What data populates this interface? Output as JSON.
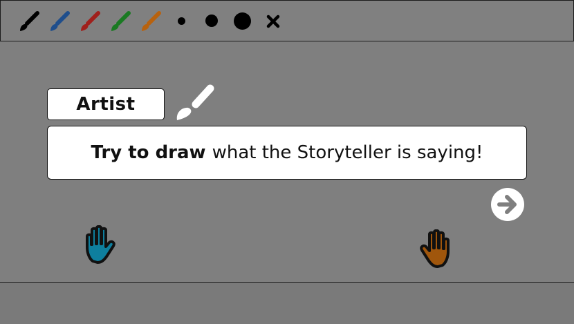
{
  "toolbar": {
    "brushes": [
      {
        "icon": "black-brush-icon",
        "color": "#000000"
      },
      {
        "icon": "blue-brush-icon",
        "color": "#1f4e8c"
      },
      {
        "icon": "red-brush-icon",
        "color": "#a0201c"
      },
      {
        "icon": "green-brush-icon",
        "color": "#1a7a22"
      },
      {
        "icon": "orange-brush-icon",
        "color": "#b8620e"
      }
    ],
    "sizes": [
      "small",
      "medium",
      "large"
    ],
    "clear_icon": "close-icon"
  },
  "role": {
    "label": "Artist",
    "icon": "paintbrush-icon"
  },
  "instruction": {
    "bold": "Try to draw",
    "rest": "what the Storyteller is saying!"
  },
  "next_icon": "arrow-right-icon",
  "players": [
    {
      "icon": "hand-icon",
      "color": "#0e7f9e"
    },
    {
      "icon": "hand-icon",
      "color": "#a0560c"
    }
  ],
  "colors": {
    "background": "#7f7f7f",
    "panel": "#ffffff",
    "outline": "#111111"
  }
}
